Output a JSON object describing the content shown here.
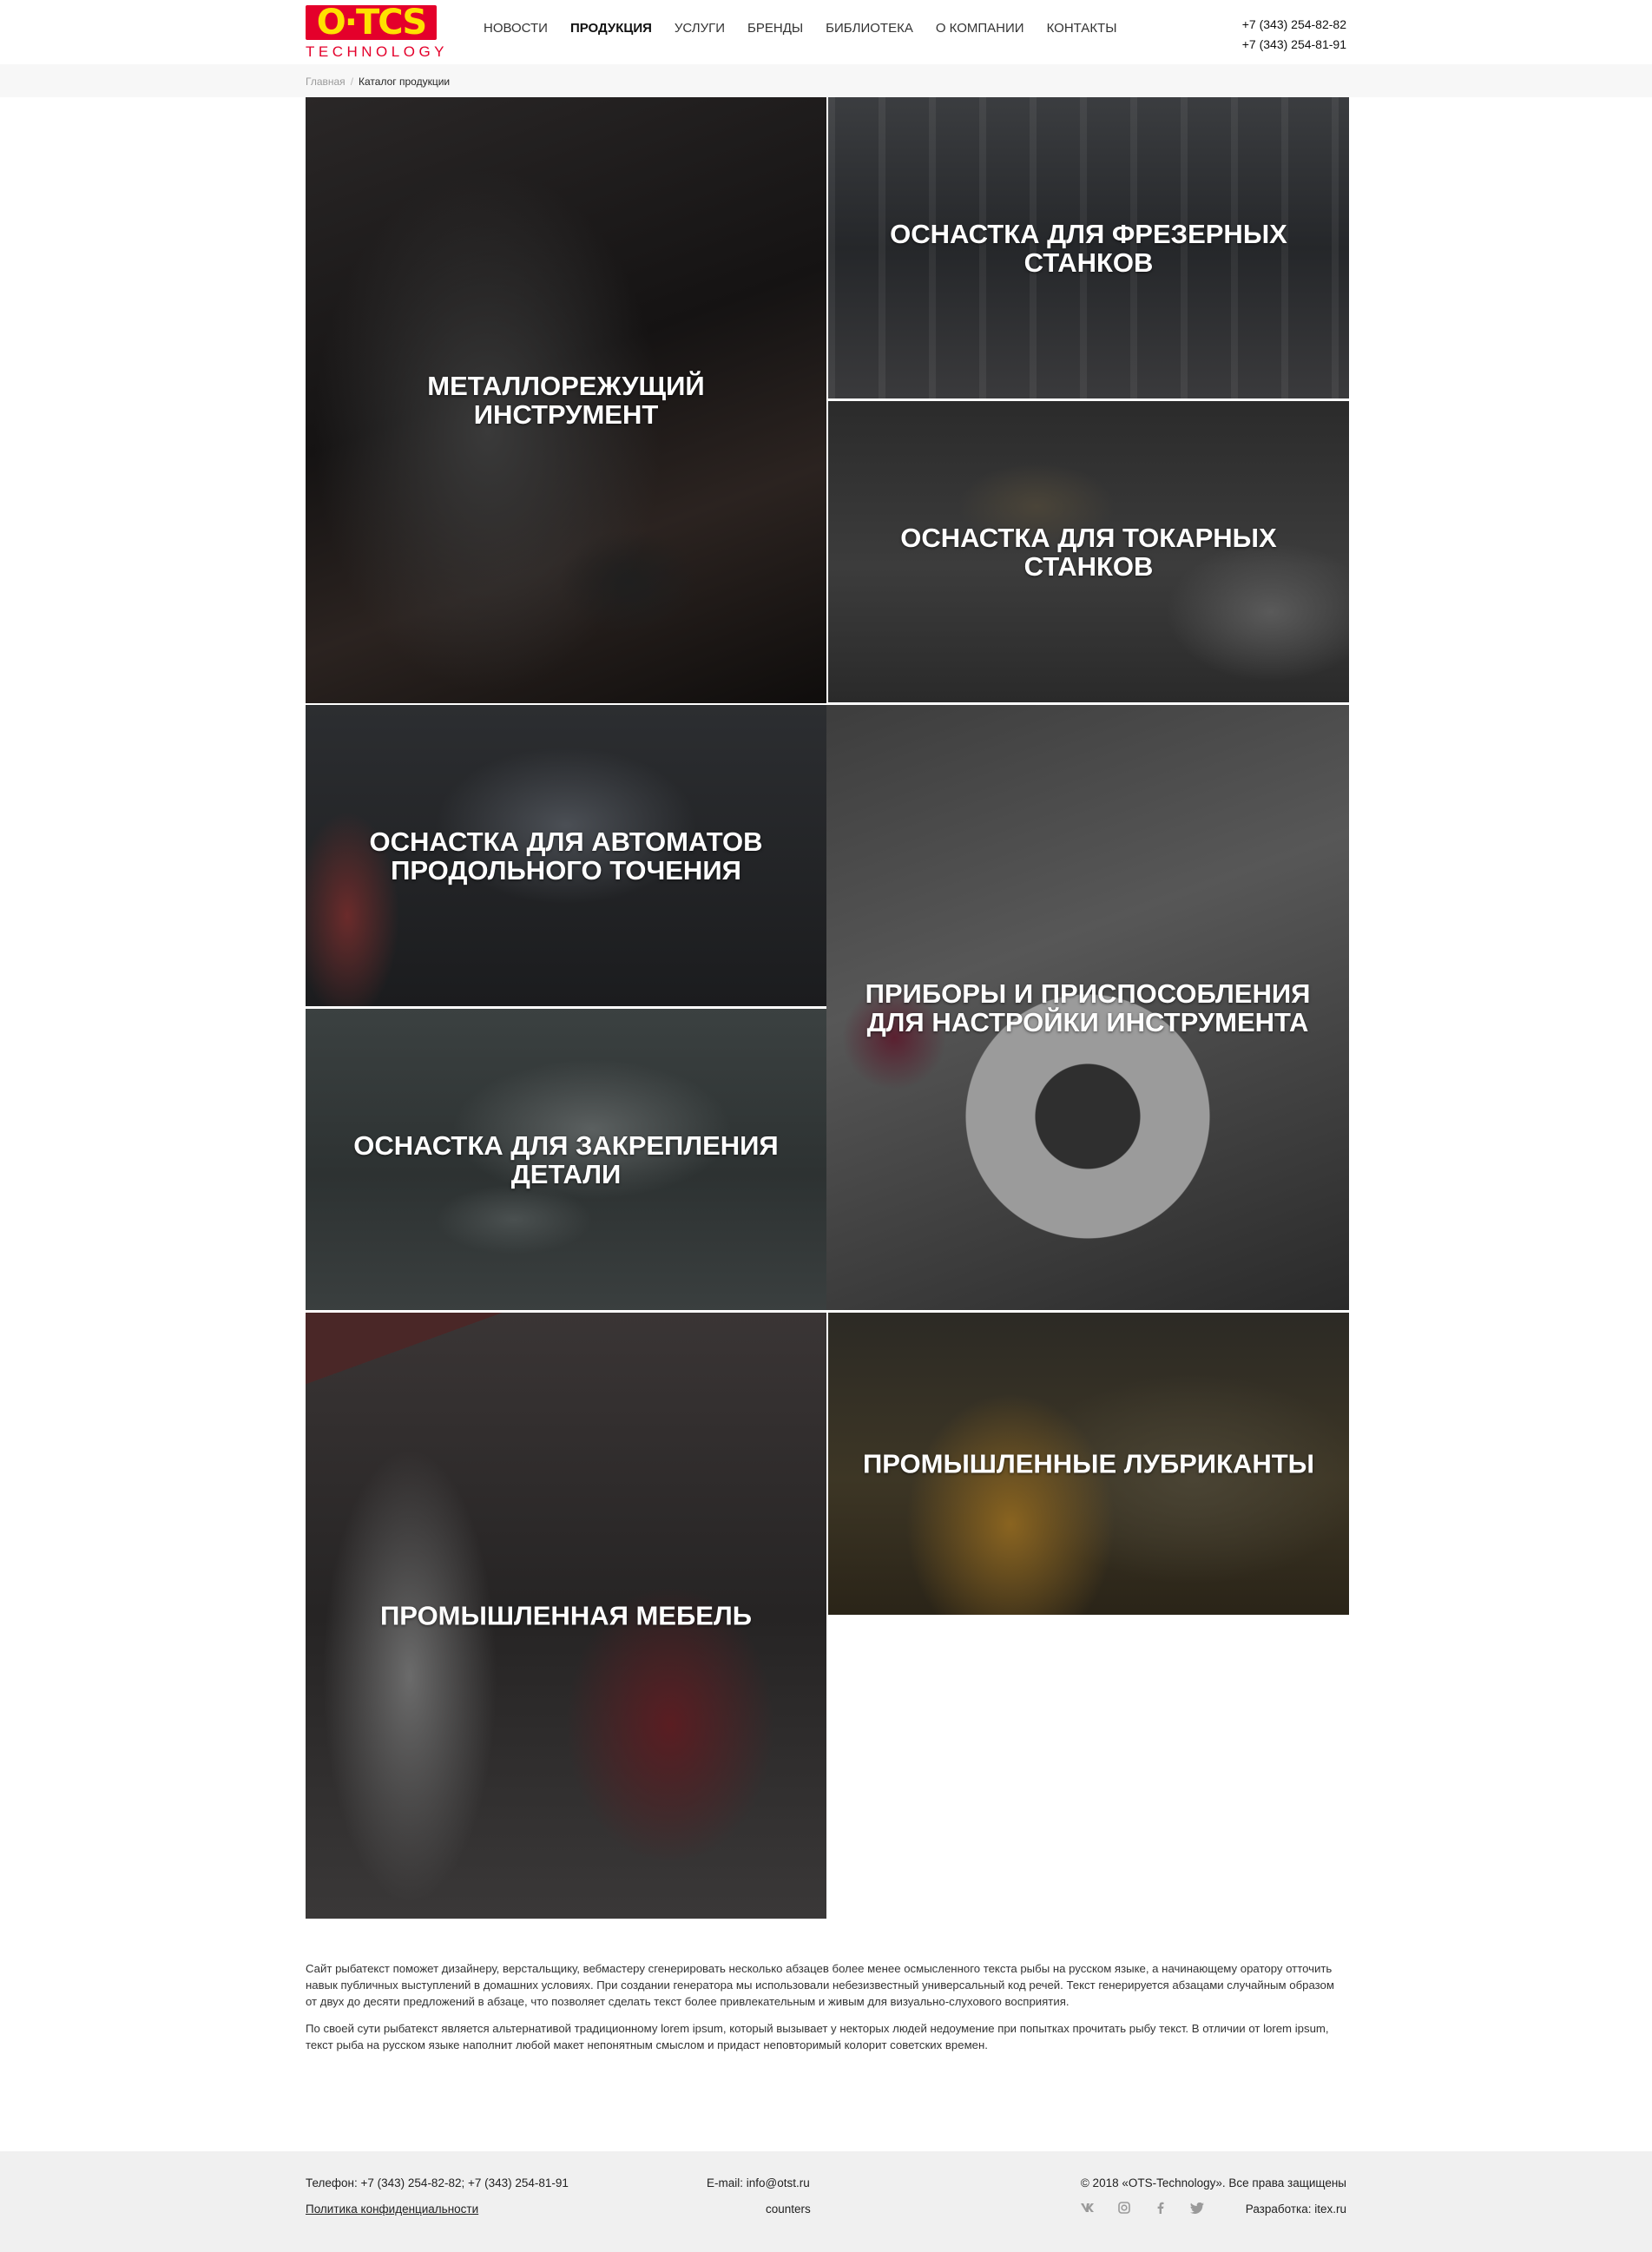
{
  "header": {
    "logo": {
      "mark": "O·TCS",
      "subtitle": "TECHNOLOGY"
    },
    "nav": [
      {
        "label": "Новости",
        "active": false
      },
      {
        "label": "Продукция",
        "active": true
      },
      {
        "label": "Услуги",
        "active": false
      },
      {
        "label": "Бренды",
        "active": false
      },
      {
        "label": "Библиотека",
        "active": false
      },
      {
        "label": "О компании",
        "active": false
      },
      {
        "label": "Контакты",
        "active": false
      }
    ],
    "phones": [
      "+7 (343) 254-82-82",
      "+7 (343) 254-81-91"
    ]
  },
  "breadcrumb": {
    "home": "Главная",
    "separator": "/",
    "current": "Каталог продукции"
  },
  "catalog": [
    {
      "title": "Металлорежущий инструмент"
    },
    {
      "title": "Оснастка для фрезерных станков"
    },
    {
      "title": "Оснастка для токарных станков"
    },
    {
      "title": "Оснастка для автоматов продольного точения"
    },
    {
      "title": "Приборы и приспособления для настройки инструмента"
    },
    {
      "title": "Оснастка для закрепления детали"
    },
    {
      "title": "Промышленная мебель"
    },
    {
      "title": "Промышленные лубриканты"
    }
  ],
  "seo_text": [
    "Сайт рыбатекст поможет дизайнеру, верстальщику, вебмастеру сгенерировать несколько абзацев более менее осмысленного текста рыбы на русском языке, а начинающему оратору отточить навык публичных выступлений в домашних условиях. При создании генератора мы использовали небезизвестный универсальный код речей. Текст генерируется абзацами случайным образом от двух до десяти предложений в абзаце, что позволяет сделать текст более привлекательным и живым для визуально-слухового восприятия.",
    "По своей сути рыбатекст является альтернативой традиционному lorem ipsum, который вызывает у некторых людей недоумение при попытках прочитать рыбу текст. В отличии от lorem ipsum, текст рыба на русском языке наполнит любой макет непонятным смыслом и придаст неповторимый колорит советских времен."
  ],
  "footer": {
    "phone": "Телефон: +7 (343) 254-82-82; +7 (343) 254-81-91",
    "policy": "Политика конфиденциальности",
    "email": "E-mail: info@otst.ru",
    "counters": "counters",
    "copyright": "© 2018 «OTS-Technology». Все права защищены",
    "developer": "Разработка: itex.ru",
    "socials": [
      "vk-icon",
      "instagram-icon",
      "facebook-icon",
      "twitter-icon"
    ]
  },
  "colors": {
    "brand_red": "#e4002b",
    "brand_yellow": "#ffe100",
    "footer_bg": "#f0f0f0"
  }
}
